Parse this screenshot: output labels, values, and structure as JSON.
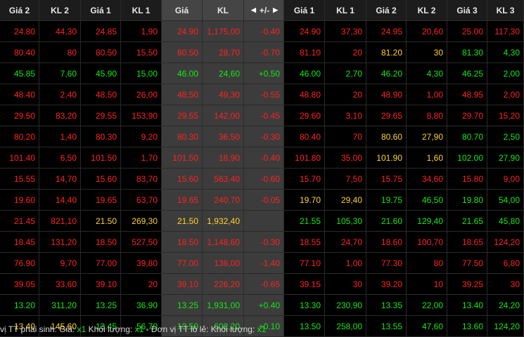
{
  "headers": [
    "Giá 2",
    "KL 2",
    "Giá 1",
    "KL 1",
    "Giá",
    "KL",
    "+/-",
    "Giá 1",
    "KL 1",
    "Giá 2",
    "KL 2",
    "Giá 3",
    "KL 3"
  ],
  "colors": {
    "red": "#ff2222",
    "green": "#14e814",
    "yellow": "#ffd32a",
    "white": "#e0e0e0",
    "background": "#000000",
    "mid_background": "#3c3c3c"
  },
  "rows": [
    {
      "values": [
        "24.80",
        "44,30",
        "24.85",
        "1,90",
        "24.90",
        "1,175,00",
        "-0.40",
        "24.90",
        "37,30",
        "24.95",
        "20,60",
        "25.00",
        "117,30"
      ],
      "colors": [
        "r",
        "r",
        "r",
        "r",
        "r",
        "r",
        "r",
        "r",
        "r",
        "r",
        "r",
        "r",
        "r"
      ]
    },
    {
      "values": [
        "80.40",
        "80",
        "80.50",
        "15,50",
        "80.50",
        "28,70",
        "-0.70",
        "81.10",
        "20",
        "81.20",
        "30",
        "81.30",
        "4,30"
      ],
      "colors": [
        "r",
        "r",
        "r",
        "r",
        "r",
        "r",
        "r",
        "r",
        "r",
        "y",
        "y",
        "g",
        "g"
      ]
    },
    {
      "values": [
        "45.85",
        "7,60",
        "45.90",
        "15,00",
        "46.00",
        "24,60",
        "+0.50",
        "46.00",
        "2,70",
        "46.20",
        "4,30",
        "46.25",
        "2,00"
      ],
      "colors": [
        "g",
        "g",
        "g",
        "g",
        "g",
        "g",
        "g",
        "g",
        "g",
        "g",
        "g",
        "g",
        "g"
      ]
    },
    {
      "values": [
        "48.40",
        "2,40",
        "48.50",
        "26,00",
        "48.50",
        "49,30",
        "-0.55",
        "48.80",
        "20",
        "48.90",
        "1,00",
        "48.95",
        "2,00"
      ],
      "colors": [
        "r",
        "r",
        "r",
        "r",
        "r",
        "r",
        "r",
        "r",
        "r",
        "r",
        "r",
        "r",
        "r"
      ]
    },
    {
      "values": [
        "29.50",
        "83,20",
        "29.55",
        "153,90",
        "29.55",
        "142,00",
        "-0.45",
        "29.60",
        "3,10",
        "29.65",
        "8,80",
        "29.70",
        "15,20"
      ],
      "colors": [
        "r",
        "r",
        "r",
        "r",
        "r",
        "r",
        "r",
        "r",
        "r",
        "r",
        "r",
        "r",
        "r"
      ]
    },
    {
      "values": [
        "80.20",
        "1,40",
        "80.30",
        "9,20",
        "80.30",
        "36,50",
        "-0.30",
        "80.40",
        "70",
        "80.60",
        "27,90",
        "80.70",
        "2,50"
      ],
      "colors": [
        "r",
        "r",
        "r",
        "r",
        "r",
        "r",
        "r",
        "r",
        "r",
        "y",
        "y",
        "g",
        "g"
      ]
    },
    {
      "values": [
        "101.40",
        "6,50",
        "101.50",
        "1,70",
        "101.50",
        "18,90",
        "-0.40",
        "101.80",
        "35,00",
        "101.90",
        "1,60",
        "102.00",
        "27,90"
      ],
      "colors": [
        "r",
        "r",
        "r",
        "r",
        "r",
        "r",
        "r",
        "r",
        "r",
        "y",
        "y",
        "g",
        "g"
      ]
    },
    {
      "values": [
        "15.55",
        "14,70",
        "15.60",
        "83,70",
        "15.60",
        "563,40",
        "-0.60",
        "15.70",
        "7,50",
        "15.75",
        "34,60",
        "15.80",
        "9,00"
      ],
      "colors": [
        "r",
        "r",
        "r",
        "r",
        "r",
        "r",
        "r",
        "r",
        "r",
        "r",
        "r",
        "r",
        "r"
      ]
    },
    {
      "values": [
        "19.60",
        "14,40",
        "19.65",
        "63,70",
        "19.65",
        "240,70",
        "-0.05",
        "19.70",
        "29,40",
        "19.75",
        "46,50",
        "19.80",
        "54,00"
      ],
      "colors": [
        "r",
        "r",
        "r",
        "r",
        "r",
        "r",
        "r",
        "y",
        "y",
        "g",
        "g",
        "g",
        "g"
      ]
    },
    {
      "values": [
        "21.45",
        "821,10",
        "21.50",
        "269,30",
        "21.50",
        "1,932,40",
        "",
        "21.55",
        "105,30",
        "21.60",
        "129,40",
        "21.65",
        "45,80"
      ],
      "colors": [
        "r",
        "r",
        "y",
        "y",
        "y",
        "y",
        "w",
        "g",
        "g",
        "g",
        "g",
        "g",
        "g"
      ]
    },
    {
      "values": [
        "18.45",
        "131,20",
        "18.50",
        "527,50",
        "18.50",
        "1,148,60",
        "-0.30",
        "18.55",
        "24,70",
        "18.60",
        "100,70",
        "18.65",
        "124,20"
      ],
      "colors": [
        "r",
        "r",
        "r",
        "r",
        "r",
        "r",
        "r",
        "r",
        "r",
        "r",
        "r",
        "r",
        "r"
      ]
    },
    {
      "values": [
        "76.90",
        "9,70",
        "77.00",
        "39,80",
        "77.00",
        "136,00",
        "-1.40",
        "77.10",
        "1,00",
        "77.30",
        "80",
        "77.50",
        "6,80"
      ],
      "colors": [
        "r",
        "r",
        "r",
        "r",
        "r",
        "r",
        "r",
        "r",
        "r",
        "r",
        "r",
        "r",
        "r"
      ]
    },
    {
      "values": [
        "39.05",
        "33,60",
        "39.10",
        "20",
        "39.10",
        "226,20",
        "-0.65",
        "39.15",
        "30",
        "39.20",
        "10",
        "39.25",
        "30"
      ],
      "colors": [
        "r",
        "r",
        "r",
        "r",
        "r",
        "r",
        "r",
        "r",
        "r",
        "r",
        "r",
        "r",
        "r"
      ]
    },
    {
      "values": [
        "13.20",
        "311,20",
        "13.25",
        "36,90",
        "13.25",
        "1,931,00",
        "+0.40",
        "13.30",
        "230,90",
        "13.35",
        "22,00",
        "13.40",
        "24,20"
      ],
      "colors": [
        "g",
        "g",
        "g",
        "g",
        "g",
        "g",
        "g",
        "g",
        "g",
        "g",
        "g",
        "g",
        "g"
      ]
    },
    {
      "values": [
        "13.40",
        "145,60",
        "13.45",
        "56,70",
        "13.50",
        "602,20",
        "+0.10",
        "13.50",
        "258,00",
        "13.55",
        "47,60",
        "13.60",
        "124,20"
      ],
      "colors": [
        "y",
        "y",
        "g",
        "g",
        "g",
        "g",
        "g",
        "g",
        "g",
        "g",
        "g",
        "g",
        "g"
      ]
    }
  ],
  "footer": {
    "text1": "vị TT phái sinh: Giá: ",
    "val1": "x1",
    "text2": " Khối lượng: ",
    "val2": "x1",
    "text3": " - Đơn vị TT lô lẻ: Khối lượng: ",
    "val3": "x1"
  }
}
